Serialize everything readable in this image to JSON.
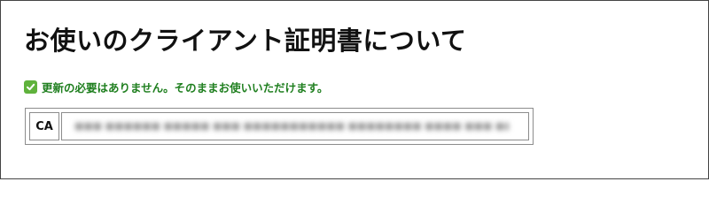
{
  "page": {
    "title": "お使いのクライアント証明書について"
  },
  "status": {
    "icon": "check-mark-icon",
    "icon_color": "#5fb23c",
    "text_color": "#1f7f1f",
    "message": "更新の必要はありません。そのままお使いいただけます。"
  },
  "certificate": {
    "label": "CA",
    "value_redacted": true
  }
}
